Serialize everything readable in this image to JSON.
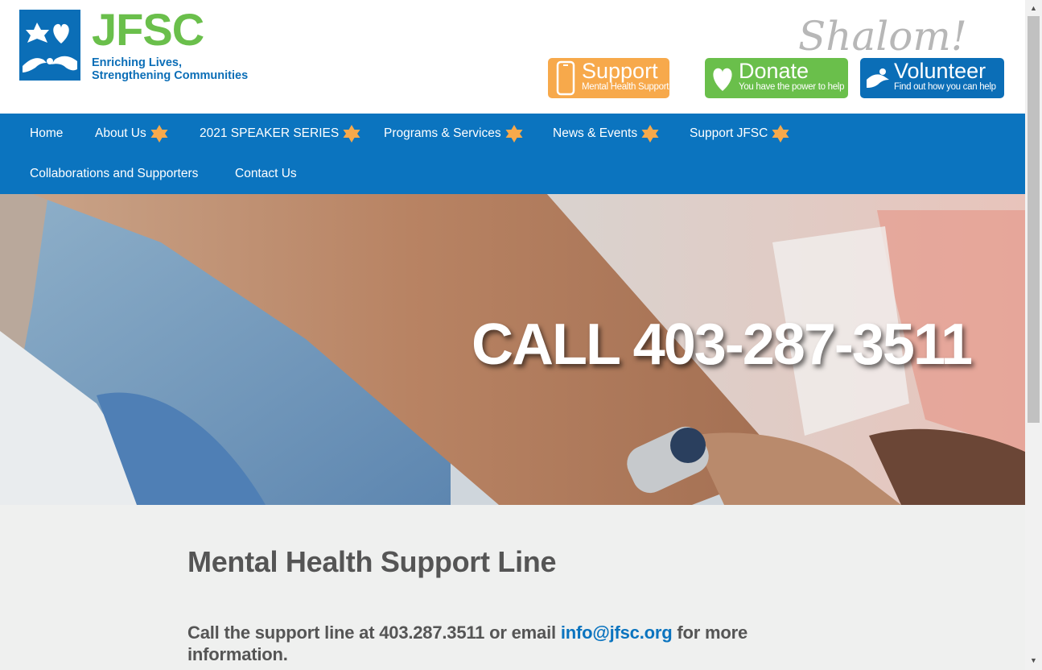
{
  "brand": {
    "logo_word": "JFSC",
    "tagline_line1": "Enriching Lives,",
    "tagline_line2": "Strengthening Communities",
    "greeting": "Shalom!",
    "brand_blue": "#0b74bf",
    "brand_green": "#6abf4b",
    "brand_orange": "#f7a94b"
  },
  "cta": {
    "support": {
      "title": "Support",
      "subtitle": "Mental Health Support Line",
      "icon": "phone-icon"
    },
    "donate": {
      "title": "Donate",
      "subtitle": "You have the power to help",
      "icon": "heart-icon"
    },
    "volunteer": {
      "title": "Volunteer",
      "subtitle": "Find out how you can help",
      "icon": "helping-hand-icon"
    }
  },
  "nav": {
    "items": [
      {
        "label": "Home",
        "has_submenu": false
      },
      {
        "label": "About Us",
        "has_submenu": true
      },
      {
        "label": "2021 SPEAKER SERIES",
        "has_submenu": true
      },
      {
        "label": "Programs & Services",
        "has_submenu": true
      },
      {
        "label": "News & Events",
        "has_submenu": true
      },
      {
        "label": "Support JFSC",
        "has_submenu": true
      },
      {
        "label": "Collaborations and Supporters",
        "has_submenu": false
      },
      {
        "label": "Contact Us",
        "has_submenu": false
      }
    ]
  },
  "hero": {
    "headline": "CALL 403-287-3511"
  },
  "content": {
    "title": "Mental Health Support Line",
    "body_prefix": "Call the support line at 403.287.3511 or email ",
    "email": "info@jfsc.org",
    "body_suffix": " for more information."
  }
}
